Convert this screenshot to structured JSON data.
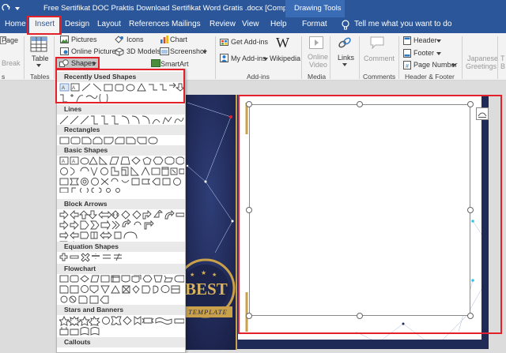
{
  "window": {
    "title": "Free Sertifikat DOC Praktis Download Sertifikat Word Gratis .docx [Compatibility Mode]...",
    "context_title": "Drawing Tools"
  },
  "tabs": [
    {
      "label": "Home"
    },
    {
      "label": "Insert",
      "selected": true
    },
    {
      "label": "Design"
    },
    {
      "label": "Layout"
    },
    {
      "label": "References"
    },
    {
      "label": "Mailings"
    },
    {
      "label": "Review"
    },
    {
      "label": "View"
    },
    {
      "label": "Help"
    },
    {
      "label": "Format"
    }
  ],
  "tell_me": "Tell me what you want to do",
  "ribbon": {
    "pages": {
      "page_label": "Page",
      "break_label": "Break",
      "group": "s"
    },
    "tables": {
      "table_label": "Table",
      "group": "Tables"
    },
    "illustrations": {
      "pictures": "Pictures",
      "online_pictures": "Online Pictures",
      "shapes": "Shapes",
      "icons": "Icons",
      "models_3d": "3D Models",
      "smartart": "SmartArt",
      "chart": "Chart",
      "screenshot": "Screenshot"
    },
    "addins": {
      "get": "Get Add-ins",
      "my": "My Add-ins",
      "wikipedia": "Wikipedia",
      "group": "Add-ins"
    },
    "media": {
      "online_video_1": "Online",
      "online_video_2": "Video",
      "group": "Media"
    },
    "links": {
      "label": "Links"
    },
    "comments": {
      "label": "Comment",
      "group": "Comments"
    },
    "header_footer": {
      "header": "Header",
      "footer": "Footer",
      "page_number": "Page Number",
      "group": "Header & Footer"
    },
    "japanese": {
      "line1": "Japanese",
      "line2": "Greetings"
    },
    "text": {
      "line1": "T",
      "line2": "B"
    }
  },
  "shapes_menu": {
    "sections": [
      {
        "title": "Recently Used Shapes"
      },
      {
        "title": "Lines"
      },
      {
        "title": "Rectangles"
      },
      {
        "title": "Basic Shapes"
      },
      {
        "title": "Block Arrows"
      },
      {
        "title": "Equation Shapes"
      },
      {
        "title": "Flowchart"
      },
      {
        "title": "Stars and Banners"
      },
      {
        "title": "Callouts"
      }
    ]
  },
  "certificate": {
    "badge_text": "BEST",
    "ribbon_text": "TEMPLATE"
  },
  "colors": {
    "ribbon_blue": "#2b579a",
    "highlight_red": "#e2212a",
    "navy": "#1f2a56",
    "gold": "#c9a14a"
  }
}
